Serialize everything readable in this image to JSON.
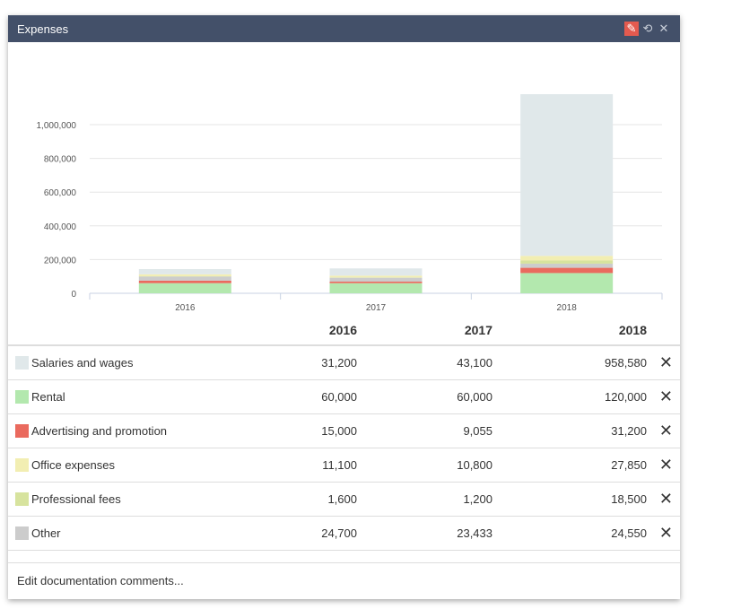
{
  "window": {
    "title": "Expenses",
    "icons": [
      "pencil-icon",
      "history-icon",
      "close-icon"
    ],
    "edit_color": "#e35a4f"
  },
  "chart_data": {
    "type": "bar",
    "stacked": true,
    "categories": [
      "2016",
      "2017",
      "2018"
    ],
    "ylim": [
      0,
      1200000
    ],
    "yticks": [
      "0",
      "200,000",
      "400,000",
      "600,000",
      "800,000",
      "1,000,000"
    ],
    "ytick_values": [
      0,
      200000,
      400000,
      600000,
      800000,
      1000000
    ],
    "grid": true,
    "stack_order": [
      "Rental",
      "Advertising and promotion",
      "Other",
      "Professional fees",
      "Office expenses",
      "Salaries and wages"
    ]
  },
  "table": {
    "years": [
      "2016",
      "2017",
      "2018"
    ],
    "rows": [
      {
        "label": "Salaries and wages",
        "color": "#e0e8ea",
        "values": [
          "31,200",
          "43,100",
          "958,580"
        ],
        "nums": [
          31200,
          43100,
          958580
        ]
      },
      {
        "label": "Rental",
        "color": "#b3e8ae",
        "values": [
          "60,000",
          "60,000",
          "120,000"
        ],
        "nums": [
          60000,
          60000,
          120000
        ]
      },
      {
        "label": "Advertising and promotion",
        "color": "#ea6a5e",
        "values": [
          "15,000",
          "9,055",
          "31,200"
        ],
        "nums": [
          15000,
          9055,
          31200
        ]
      },
      {
        "label": "Office expenses",
        "color": "#f2eeb2",
        "values": [
          "11,100",
          "10,800",
          "27,850"
        ],
        "nums": [
          11100,
          10800,
          27850
        ]
      },
      {
        "label": "Professional fees",
        "color": "#d7e39e",
        "values": [
          "1,600",
          "1,200",
          "18,500"
        ],
        "nums": [
          1600,
          1200,
          18500
        ]
      },
      {
        "label": "Other",
        "color": "#cccccc",
        "values": [
          "24,700",
          "23,433",
          "24,550"
        ],
        "nums": [
          24700,
          23433,
          24550
        ]
      }
    ],
    "remove_icon": "close-icon"
  },
  "footer": {
    "link": "Edit documentation comments..."
  }
}
